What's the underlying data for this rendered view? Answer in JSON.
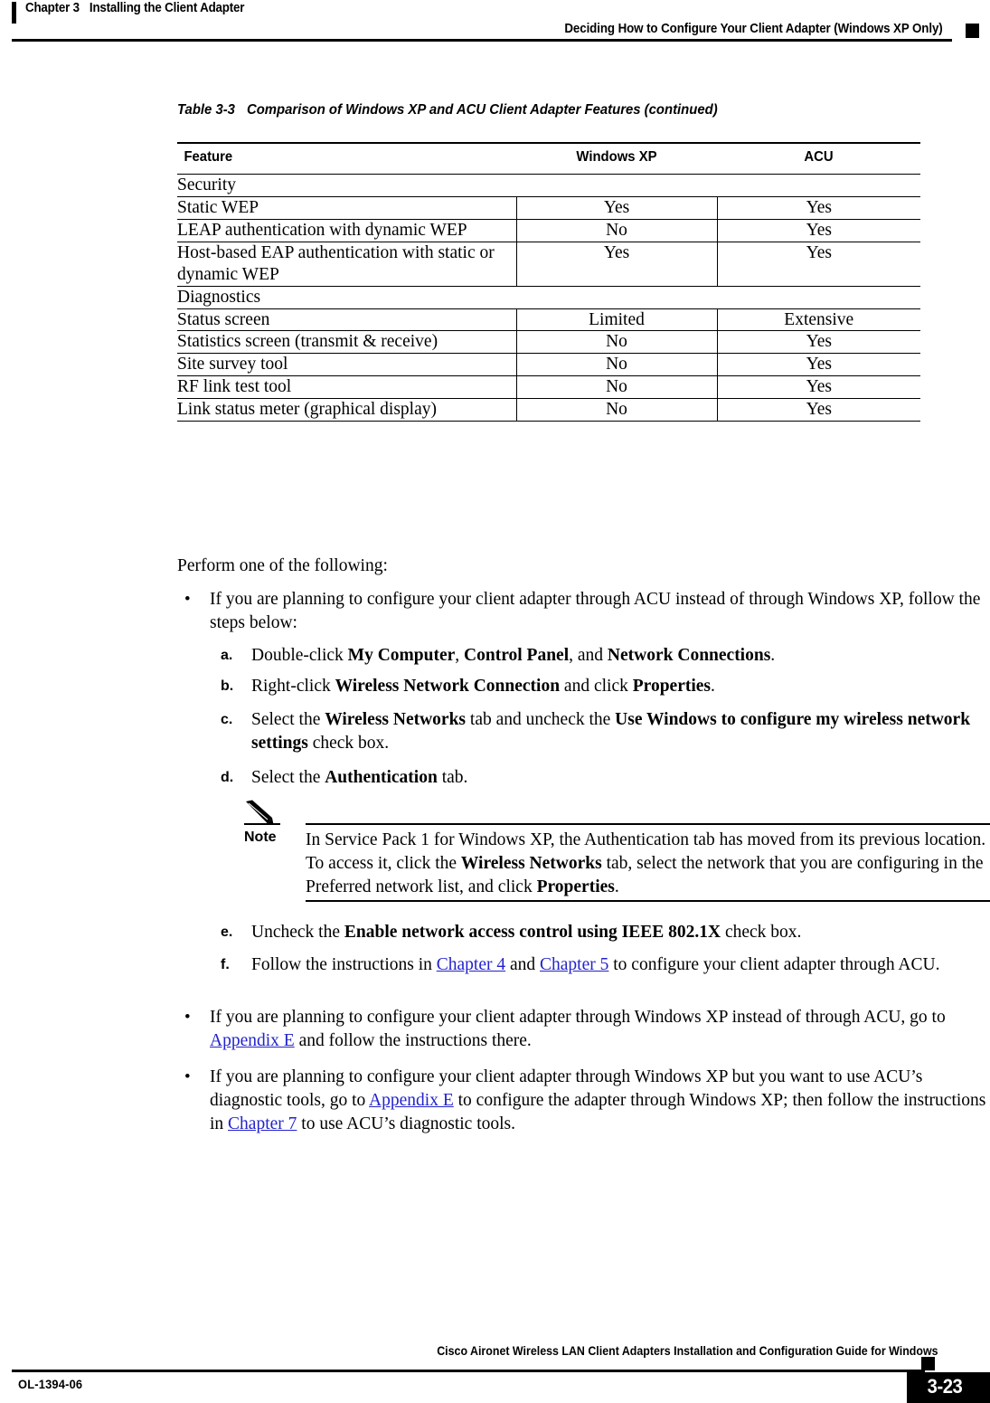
{
  "header": {
    "chapter_number": "Chapter 3",
    "chapter_title": "Installing the Client Adapter",
    "section_title": "Deciding How to Configure Your Client Adapter (Windows XP Only)"
  },
  "table": {
    "label": "Table 3-3",
    "caption": "Comparison of Windows XP and ACU Client Adapter Features (continued)",
    "columns": [
      "Feature",
      "Windows XP",
      "ACU"
    ],
    "groups": [
      {
        "name": "Security",
        "rows": [
          {
            "feature": "Static WEP",
            "winxp": "Yes",
            "acu": "Yes"
          },
          {
            "feature": "LEAP authentication with dynamic WEP",
            "winxp": "No",
            "acu": "Yes"
          },
          {
            "feature": "Host-based EAP authentication with static or dynamic WEP",
            "winxp": "Yes",
            "acu": "Yes"
          }
        ]
      },
      {
        "name": "Diagnostics",
        "rows": [
          {
            "feature": "Status screen",
            "winxp": "Limited",
            "acu": "Extensive"
          },
          {
            "feature": "Statistics screen (transmit & receive)",
            "winxp": "No",
            "acu": "Yes"
          },
          {
            "feature": "Site survey tool",
            "winxp": "No",
            "acu": "Yes"
          },
          {
            "feature": "RF link test tool",
            "winxp": "No",
            "acu": "Yes"
          },
          {
            "feature": "Link status meter (graphical display)",
            "winxp": "No",
            "acu": "Yes"
          }
        ]
      }
    ]
  },
  "body": {
    "lead": "Perform one of the following:",
    "bullet_marker": "•",
    "bullet_1_intro": "If you are planning to configure your client adapter through ACU instead of through Windows XP, follow the steps below:",
    "steps": {
      "a": {
        "letter": "a.",
        "t1": "Double-click ",
        "b1": "My Computer",
        "t2": ", ",
        "b2": "Control Panel",
        "t3": ", and ",
        "b3": "Network Connections",
        "t4": "."
      },
      "b": {
        "letter": "b.",
        "t1": "Right-click ",
        "b1": "Wireless Network Connection",
        "t2": " and click ",
        "b2": "Properties",
        "t3": "."
      },
      "c": {
        "letter": "c.",
        "t1": "Select the ",
        "b1": "Wireless Networks",
        "t2": " tab and uncheck the ",
        "b2": "Use Windows to configure my wireless network settings",
        "t3": " check box."
      },
      "d": {
        "letter": "d.",
        "t1": "Select the ",
        "b1": "Authentication",
        "t2": " tab."
      },
      "e": {
        "letter": "e.",
        "t1": "Uncheck the ",
        "b1": "Enable network access control using IEEE 802.1X",
        "t2": " check box."
      },
      "f": {
        "letter": "f.",
        "t1": "Follow the instructions in ",
        "x1": "Chapter 4",
        "t2": " and ",
        "x2": "Chapter 5",
        "t3": " to configure your client adapter through ACU."
      }
    },
    "note": {
      "icon": "pencil-icon",
      "label": "Note",
      "t1": "In Service Pack 1 for Windows XP, the Authentication tab has moved from its previous location. To access it, click the ",
      "b1": "Wireless Networks",
      "t2": " tab, select the network that you are configuring in the Preferred network list, and click ",
      "b2": "Properties",
      "t3": "."
    },
    "bullet_2": {
      "t1": "If you are planning to configure your client adapter through Windows XP instead of through ACU, go to ",
      "x1": "Appendix E",
      "t2": " and follow the instructions there."
    },
    "bullet_3": {
      "t1": "If you are planning to configure your client adapter through Windows XP but you want to use ACU’s diagnostic tools, go to ",
      "x1": "Appendix E",
      "t2": " to configure the adapter through Windows XP; then follow the instructions in ",
      "x2": "Chapter 7",
      "t3": " to use ACU’s diagnostic tools."
    }
  },
  "footer": {
    "guide_title": "Cisco Aironet Wireless LAN Client Adapters Installation and Configuration Guide for Windows",
    "doc_id": "OL-1394-06",
    "page_number": "3-23"
  },
  "colors": {
    "text": "#000000",
    "crossreference_link": "#2222cc",
    "rule": "#000000",
    "page_number_background": "#000000",
    "page_number_text": "#ffffff"
  }
}
